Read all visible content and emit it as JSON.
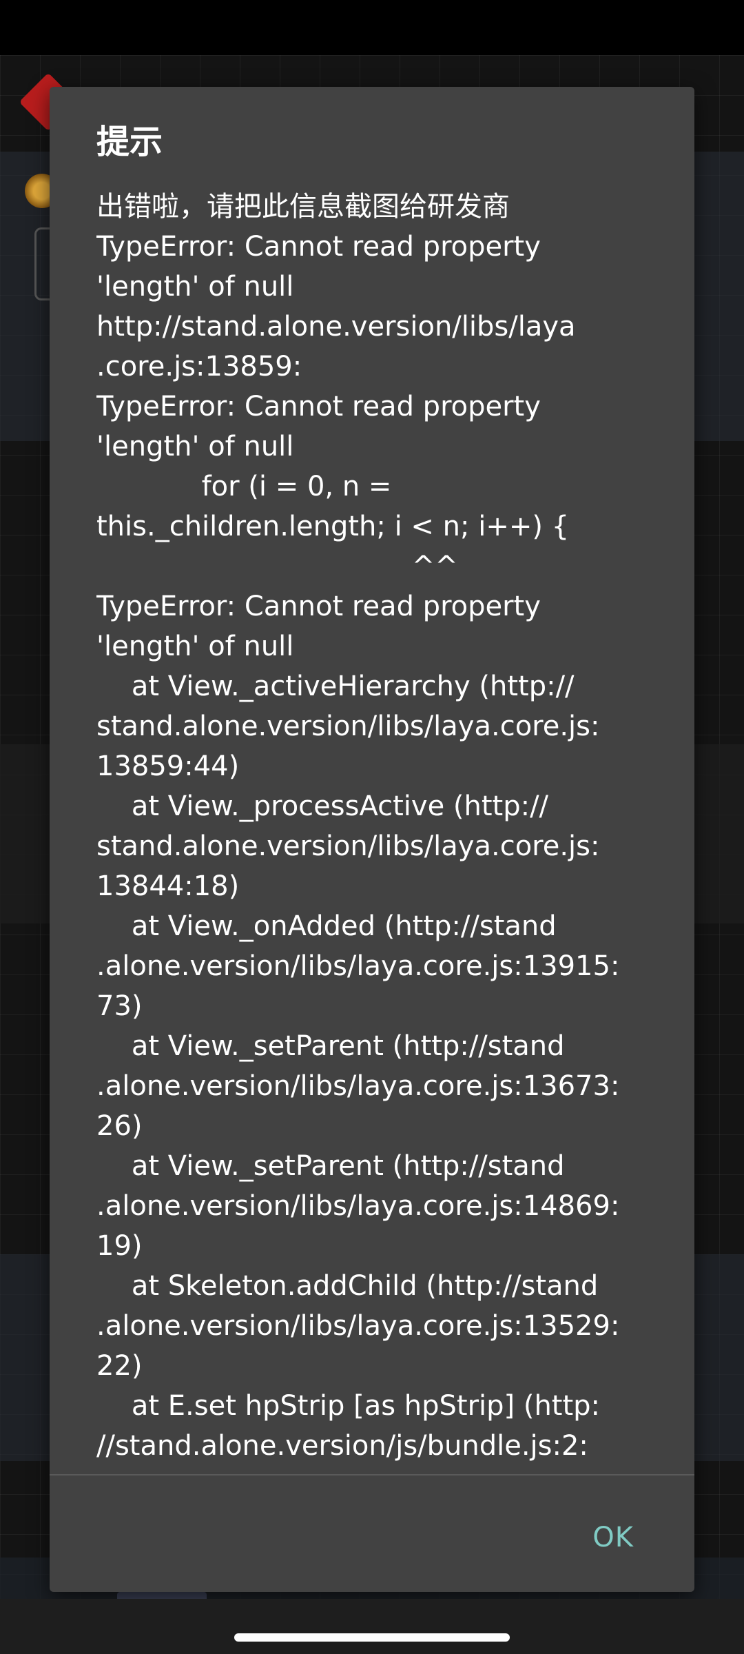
{
  "dialog": {
    "title": "提示",
    "message": "出错啦，请把此信息截图给研发商\nTypeError: Cannot read property\n'length' of null\nhttp://stand.alone.version/libs/laya\n.core.js:13859:\nTypeError: Cannot read property\n'length' of null\n            for (i = 0, n =\nthis._children.length; i < n; i++) {\n                                    ^^\nTypeError: Cannot read property\n'length' of null\n    at View._activeHierarchy (http://\nstand.alone.version/libs/laya.core.js:\n13859:44)\n    at View._processActive (http://\nstand.alone.version/libs/laya.core.js:\n13844:18)\n    at View._onAdded (http://stand\n.alone.version/libs/laya.core.js:13915:\n73)\n    at View._setParent (http://stand\n.alone.version/libs/laya.core.js:13673:\n26)\n    at View._setParent (http://stand\n.alone.version/libs/laya.core.js:14869:\n19)\n    at Skeleton.addChild (http://stand\n.alone.version/libs/laya.core.js:13529:\n22)\n    at E.set hpStrip [as hpStrip] (http:\n//stand.alone.version/js/bundle.js:2:",
    "ok_label": "OK"
  },
  "colors": {
    "dialog_background": "#424242",
    "ok_accent": "#80cbc4",
    "text": "#ffffff"
  }
}
